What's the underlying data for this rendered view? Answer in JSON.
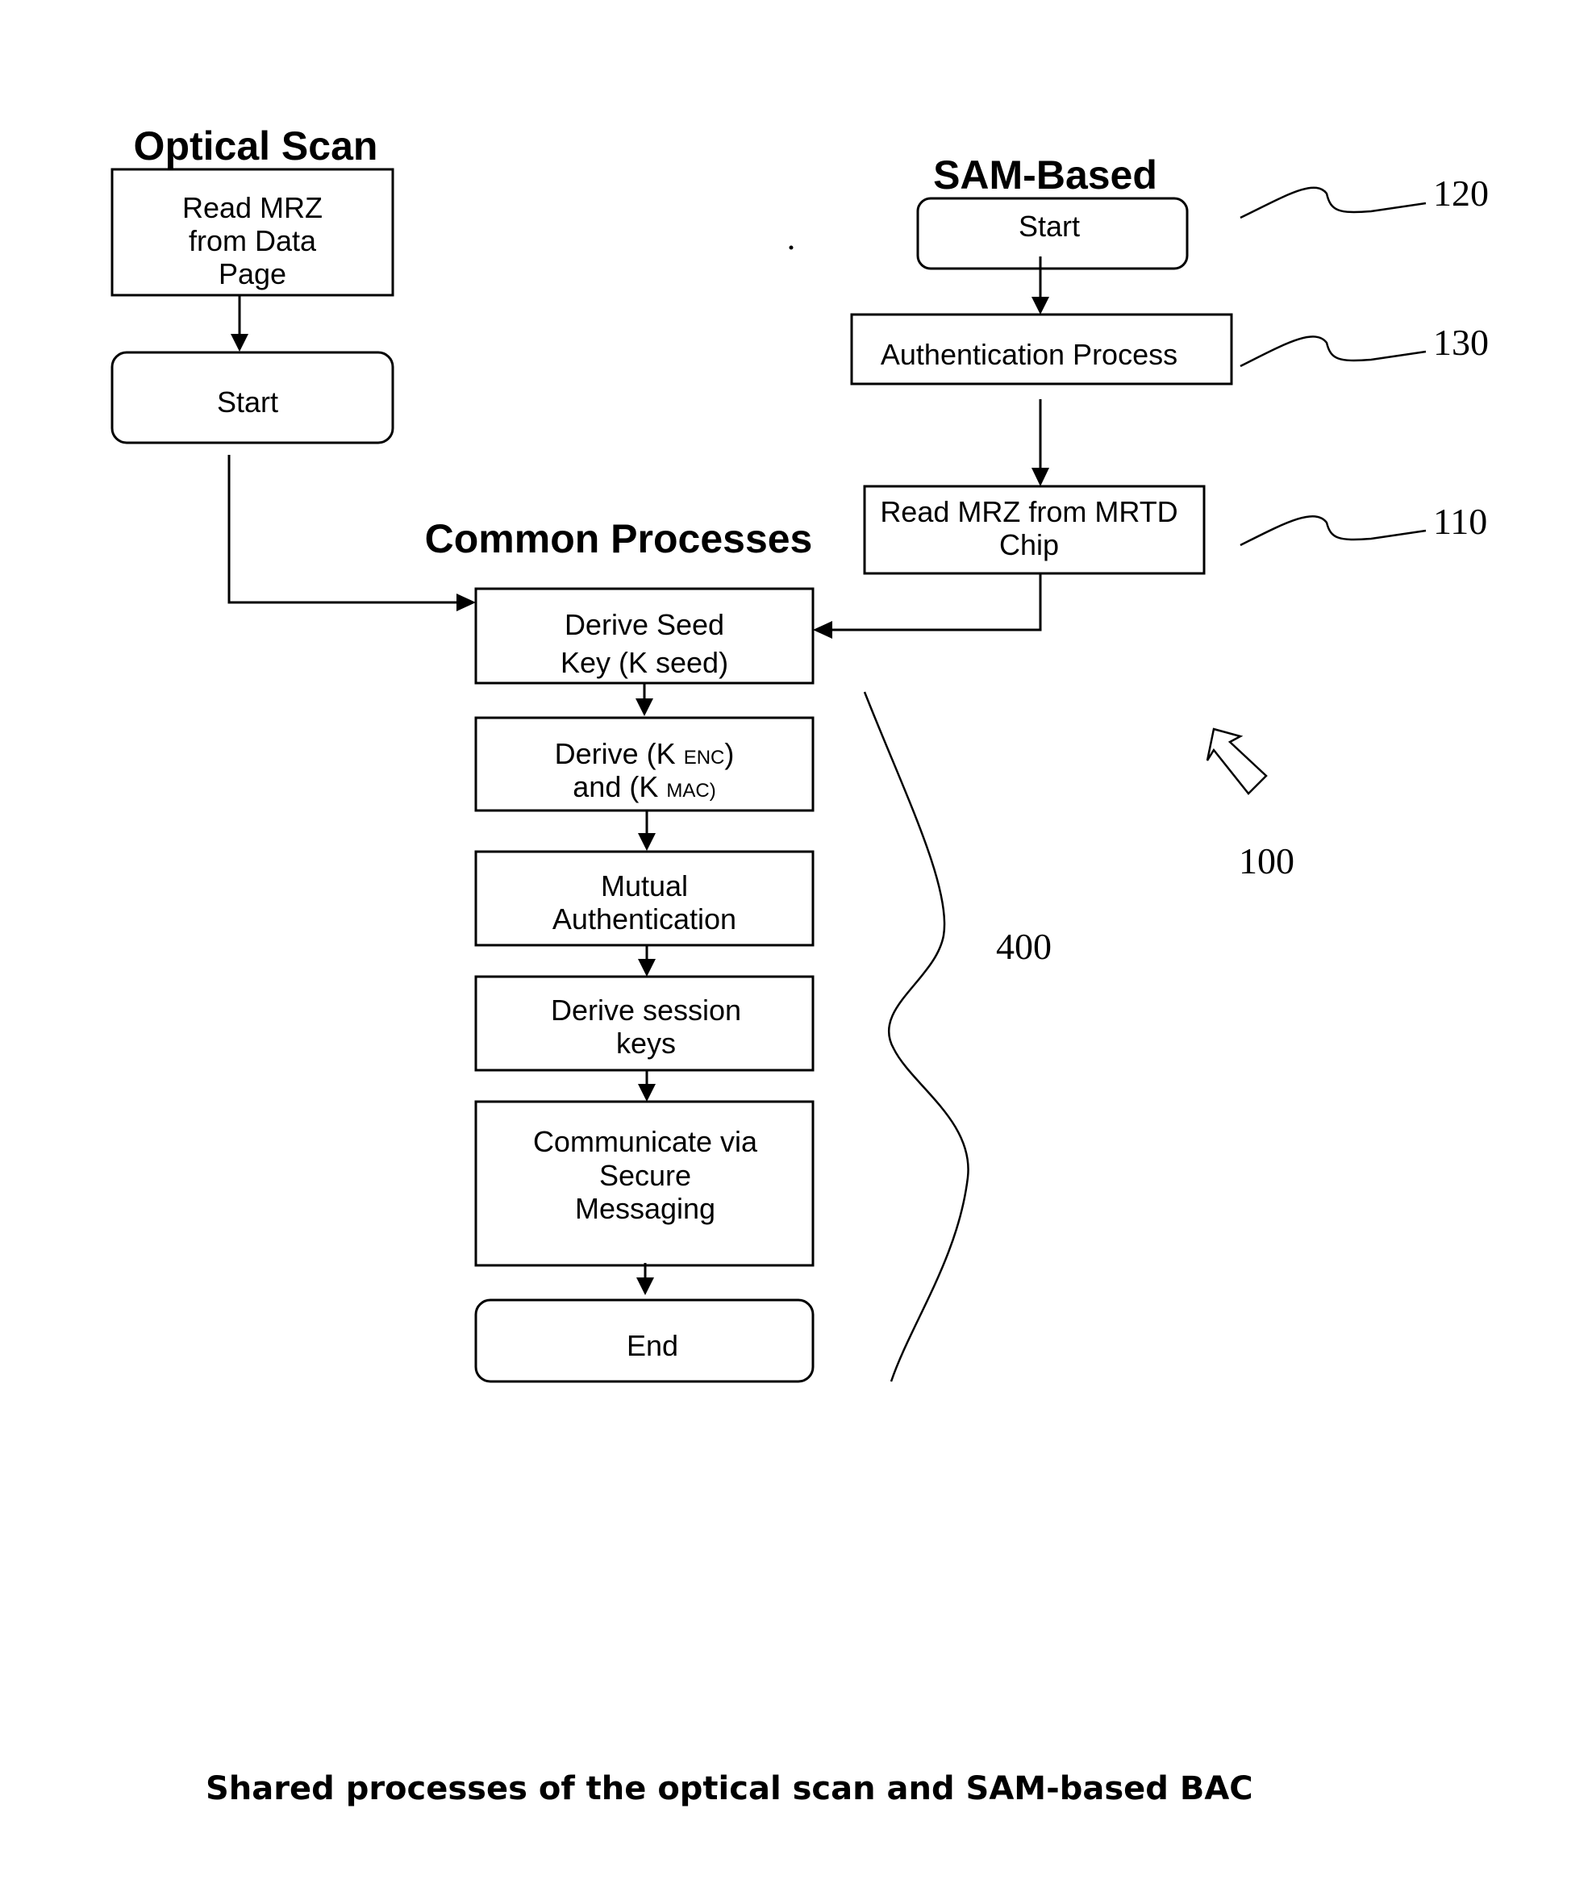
{
  "diagram": {
    "sections": {
      "optical_scan": "Optical Scan",
      "sam_based": "SAM-Based",
      "common_processes": "Common Processes"
    },
    "optical_scan": {
      "read_mrz": [
        "Read MRZ",
        "from Data",
        "Page"
      ],
      "start": "Start"
    },
    "sam_based": {
      "start": "Start",
      "authentication": "Authentication Process",
      "read_chip": [
        "Read MRZ from MRTD",
        "Chip"
      ]
    },
    "common": {
      "derive_seed": {
        "line1": "Derive Seed",
        "line2_main": "Key (K",
        "line2_sub": "seed)"
      },
      "derive_enc_mac": {
        "line1_main": "Derive (K",
        "line1_sub": "ENC",
        "line1_end": ")",
        "line2_main": "and (K",
        "line2_sub": "MAC)"
      },
      "mutual_auth": [
        "Mutual",
        "Authentication"
      ],
      "session_keys": [
        "Derive session",
        "keys"
      ],
      "secure_messaging": [
        "Communicate via",
        "Secure",
        "Messaging"
      ],
      "end": "End"
    },
    "reference_numerals": {
      "r120": "120",
      "r130": "130",
      "r110": "110",
      "r100": "100",
      "r400": "400"
    },
    "caption": "Shared processes of the optical scan and SAM-based BAC"
  }
}
